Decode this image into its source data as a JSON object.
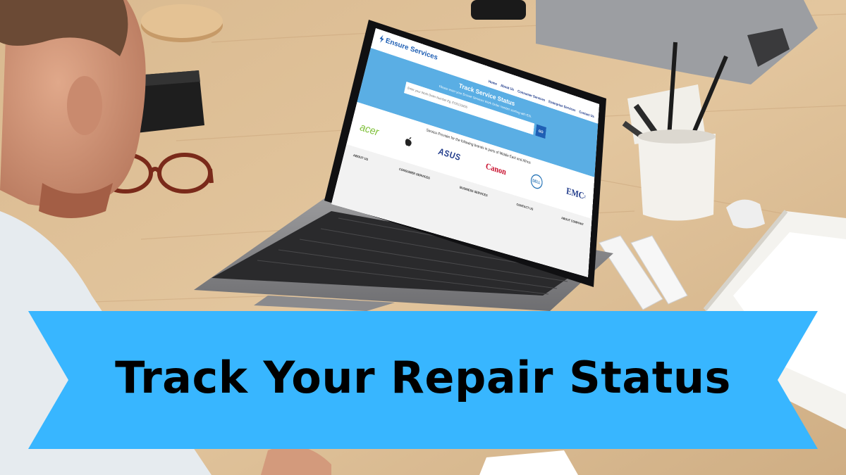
{
  "banner": {
    "title": "Track Your Repair Status",
    "color": "#38b6ff"
  },
  "website": {
    "logo_text": "Ensure Services",
    "nav": [
      "Home",
      "About Us",
      "Consumer Services",
      "Enterprise Services",
      "Contact Us"
    ],
    "hero": {
      "title": "Track Service Status",
      "subtitle": "Please enter your Ensure Services Work Order number starting with ESI.",
      "input_placeholder": "Enter your Work Order Number Eg. ESI0123456",
      "go_label": "GO",
      "background_color": "#5aaee4"
    },
    "brands_caption": "Service Provider for the following brands in parts of Middle East and Africa",
    "brands": [
      "acer",
      "apple-logo",
      "ASUS",
      "Canon",
      "DELL",
      "EMC"
    ],
    "footer_links": [
      "ABOUT US",
      "CONSUMER SERVICES",
      "BUSINESS SERVICES",
      "CONTACT US",
      "ABOUT COMPANY"
    ]
  },
  "scene_icons": [
    "person",
    "eyeglasses",
    "wallet",
    "laptop",
    "keyboard",
    "pencil-cup",
    "markers",
    "notepad",
    "coffee-mug",
    "second-laptop"
  ]
}
